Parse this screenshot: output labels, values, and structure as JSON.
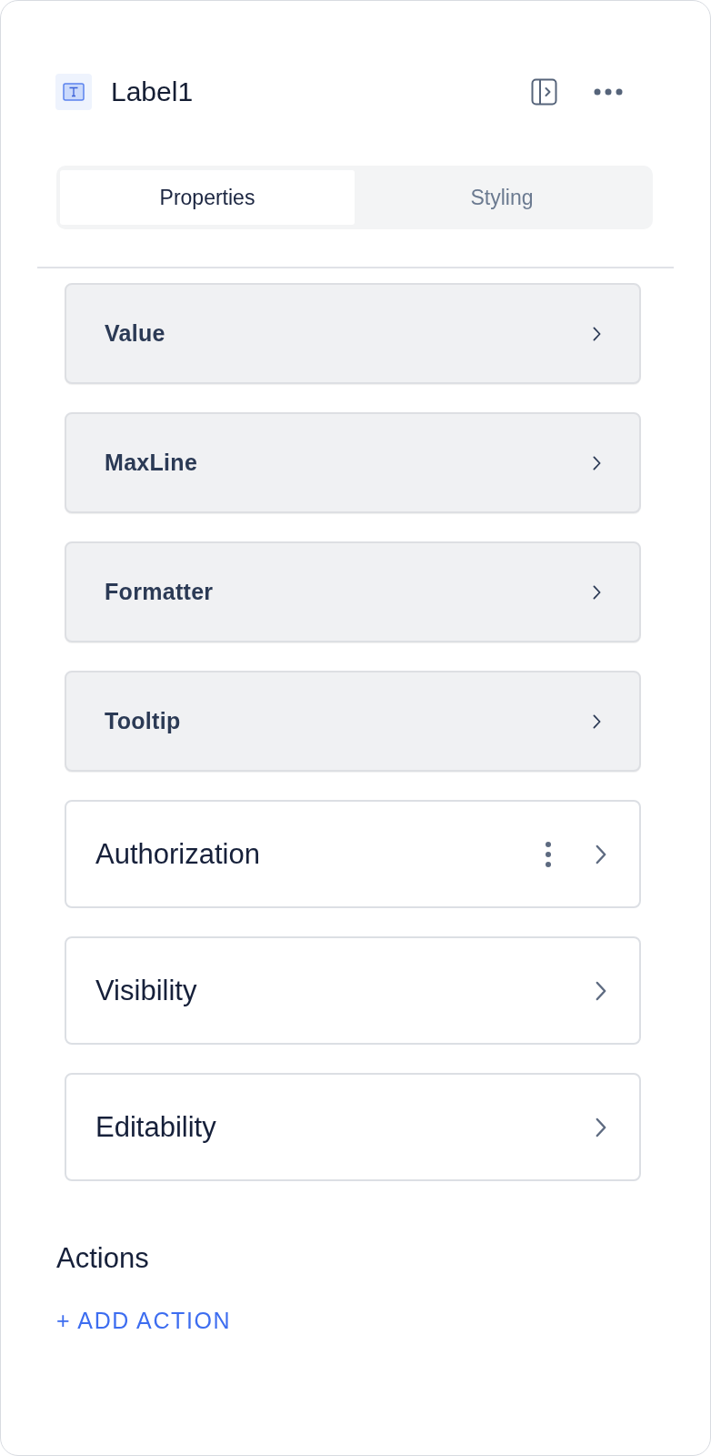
{
  "header": {
    "title": "Label1"
  },
  "tabs": [
    {
      "label": "Properties",
      "selected": true
    },
    {
      "label": "Styling",
      "selected": false
    }
  ],
  "rows": [
    {
      "kind": "property",
      "label": "Value",
      "menu": false
    },
    {
      "kind": "property",
      "label": "MaxLine",
      "menu": false
    },
    {
      "kind": "property",
      "label": "Formatter",
      "menu": false
    },
    {
      "kind": "property",
      "label": "Tooltip",
      "menu": false
    },
    {
      "kind": "section",
      "label": "Authorization",
      "menu": true
    },
    {
      "kind": "section",
      "label": "Visibility",
      "menu": false
    },
    {
      "kind": "section",
      "label": "Editability",
      "menu": false
    }
  ],
  "actions": {
    "title": "Actions",
    "add_button": "+ ADD ACTION"
  }
}
